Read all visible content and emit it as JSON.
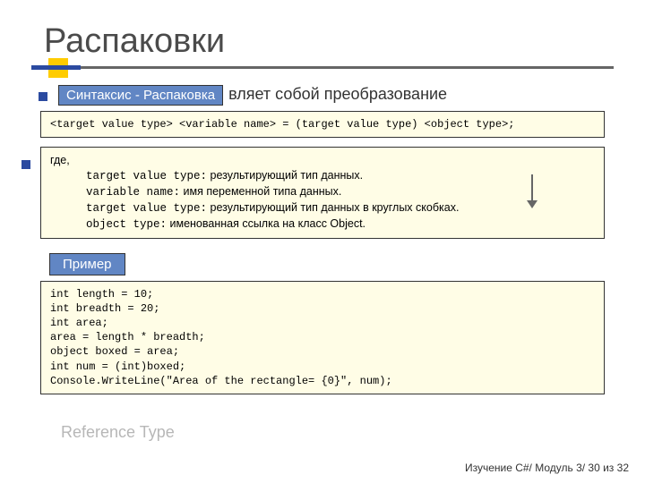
{
  "title": "Распаковки",
  "syntax_label": "Синтаксис - Распаковка",
  "lead_fragment": "вляет собой преобразование",
  "code_syntax": "<target value type> <variable name> = (target value type) <object type>;",
  "desc_where": "где,",
  "desc_lines": [
    {
      "term": "target value type:",
      "expl": " результирующий тип данных."
    },
    {
      "term": "variable name:",
      "expl": " имя переменной типа данных."
    },
    {
      "term": "target value type:",
      "expl": " результирующий тип данных в круглых скобках."
    },
    {
      "term": "object type:",
      "expl": " именованная ссылка на класс Object."
    }
  ],
  "example_label": "Пример",
  "example_code": "int length = 10;\nint breadth = 20;\nint area;\narea = length * breadth;\nobject boxed = area;\nint num = (int)boxed;\nConsole.WriteLine(\"Area of the rectangle= {0}\", num);",
  "ghost": "...",
  "faded_caption": "Reference Type",
  "footer": "Изучение C#/ Модуль 3/ 30 из 32"
}
